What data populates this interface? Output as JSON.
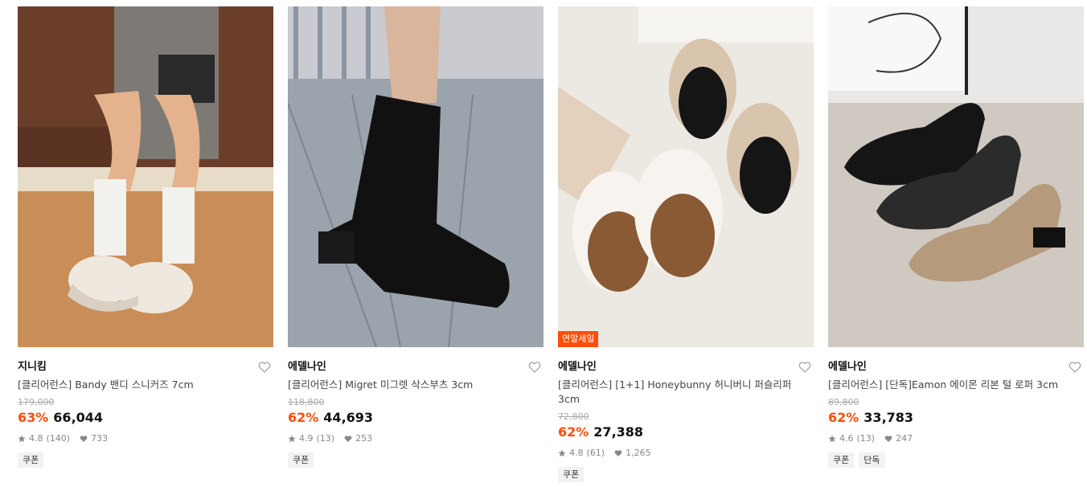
{
  "products": [
    {
      "brand": "지니킴",
      "title": "[클리어런스] Bandy 밴디 스니커즈 7cm",
      "original_price": "179,000",
      "discount": "63%",
      "price": "66,044",
      "rating": "4.8",
      "reviews": "(140)",
      "likes": "733",
      "tags": [
        "쿠폰"
      ],
      "badge": "",
      "image": "sneakers-photo"
    },
    {
      "brand": "에델나인",
      "title": "[클리어런스] Migret 미그렛 삭스부츠 3cm",
      "original_price": "118,800",
      "discount": "62%",
      "price": "44,693",
      "rating": "4.9",
      "reviews": "(13)",
      "likes": "253",
      "tags": [
        "쿠폰"
      ],
      "badge": "",
      "image": "ankle-boot-photo"
    },
    {
      "brand": "에델나인",
      "title": "[클리어런스] [1+1] Honeybunny 허니버니 퍼슬리퍼 3cm",
      "original_price": "72,800",
      "discount": "62%",
      "price": "27,388",
      "rating": "4.8",
      "reviews": "(61)",
      "likes": "1,265",
      "tags": [
        "쿠폰"
      ],
      "badge": "연말세일",
      "image": "fur-slippers-photo"
    },
    {
      "brand": "에델나인",
      "title": "[클리어런스] [단독]Eamon 에이몬 리본 털 로퍼 3cm",
      "original_price": "89,800",
      "discount": "62%",
      "price": "33,783",
      "rating": "4.6",
      "reviews": "(13)",
      "likes": "247",
      "tags": [
        "쿠폰",
        "단독"
      ],
      "badge": "",
      "image": "loafers-photo"
    }
  ],
  "colors": {
    "accent": "#ff4e0a",
    "muted": "#888888"
  }
}
